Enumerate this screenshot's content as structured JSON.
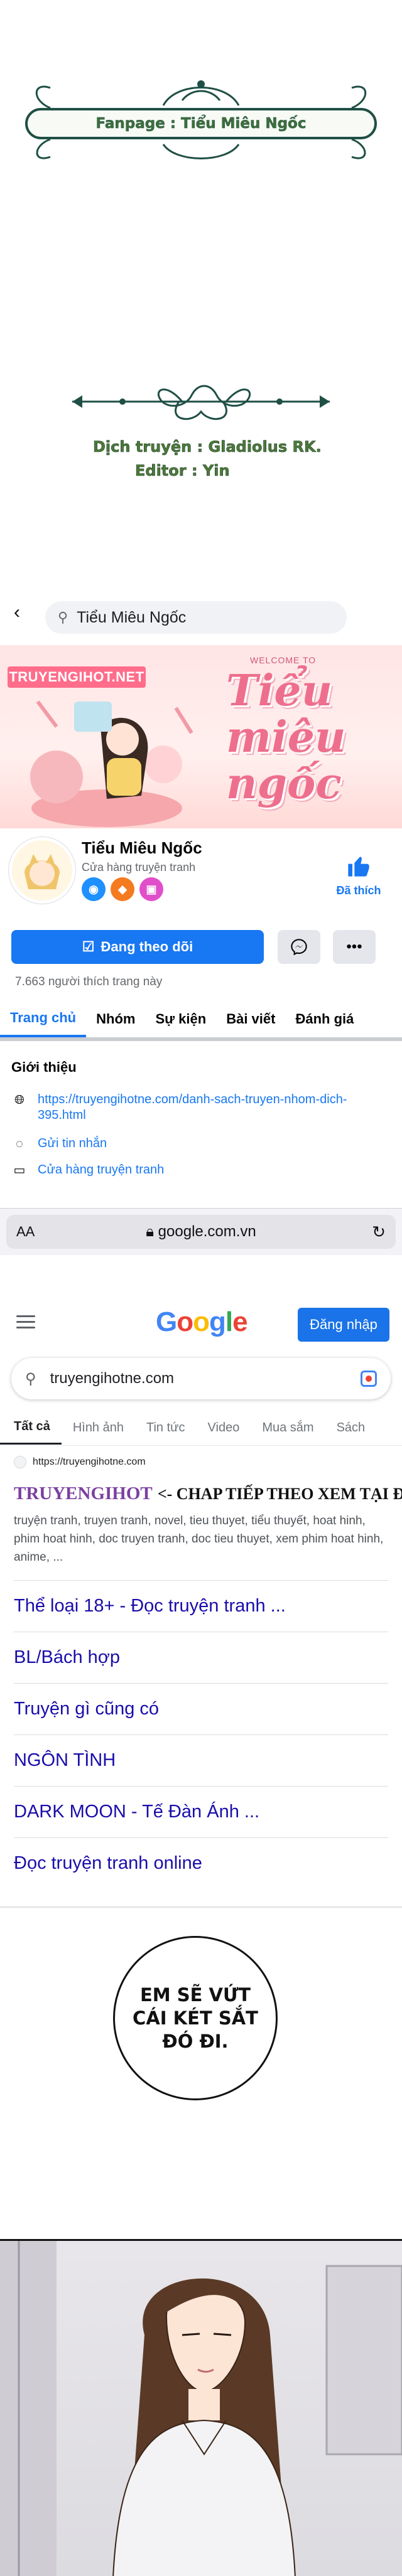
{
  "credits": {
    "fanpage_banner": "Fanpage : Tiểu Miêu Ngốc",
    "translator": "Dịch truyện : Gladiolus RK.",
    "editor": "Editor : Yin"
  },
  "facebook": {
    "search_text": "Tiểu Miêu Ngốc",
    "cover": {
      "logo": "TRUYENGIHOT.NET",
      "welcome": "WELCOME TO",
      "title": "Tiểu miêu ngốc"
    },
    "page_name": "Tiểu Miêu Ngốc",
    "page_category": "Cửa hàng truyện tranh",
    "like_label": "Đã thích",
    "follow_label": "Đang theo dõi",
    "likes_count": "7.663 người thích trang này",
    "tabs": [
      "Trang chủ",
      "Nhóm",
      "Sự kiện",
      "Bài viết",
      "Đánh giá"
    ],
    "intro_title": "Giới thiệu",
    "intro_link": "https://truyengihotne.com/danh-sach-truyen-nhom-dich-395.html",
    "send_message": "Gửi tin nhắn",
    "category_link": "Cửa hàng truyện tranh",
    "colors": {
      "accent": "#1877f2"
    }
  },
  "browser": {
    "aa_label": "AA",
    "url": "google.com.vn"
  },
  "google": {
    "logo": "Google",
    "signin_label": "Đăng nhập",
    "query": "truyengihotne.com",
    "tabs": [
      "Tất cả",
      "Hình ảnh",
      "Tin tức",
      "Video",
      "Mua sắm",
      "Sách"
    ],
    "result": {
      "url": "https://truyengihotne.com",
      "title_brand": "TRUYENGIHOT",
      "title_rest": "<- CHAP TIẾP THEO XEM TẠI ĐÂY NHA",
      "snippet": "truyện tranh, truyen tranh, novel, tieu thuyet, tiểu thuyết, hoat hinh, phim hoat hinh, doc truyen tranh, doc tieu thuyet, xem phim hoat hinh, anime, ..."
    },
    "sitelinks": [
      "Thể loại 18+ - Đọc truyện tranh ...",
      "BL/Bách hợp",
      "Truyện gì cũng có",
      "NGÔN TÌNH",
      "DARK MOON - Tế Đàn Ánh ...",
      "Đọc truyện tranh online"
    ]
  },
  "comic": {
    "bubble": "EM SẼ VỨT\nCÁI KÉT SẮT\nĐÓ ĐI."
  }
}
